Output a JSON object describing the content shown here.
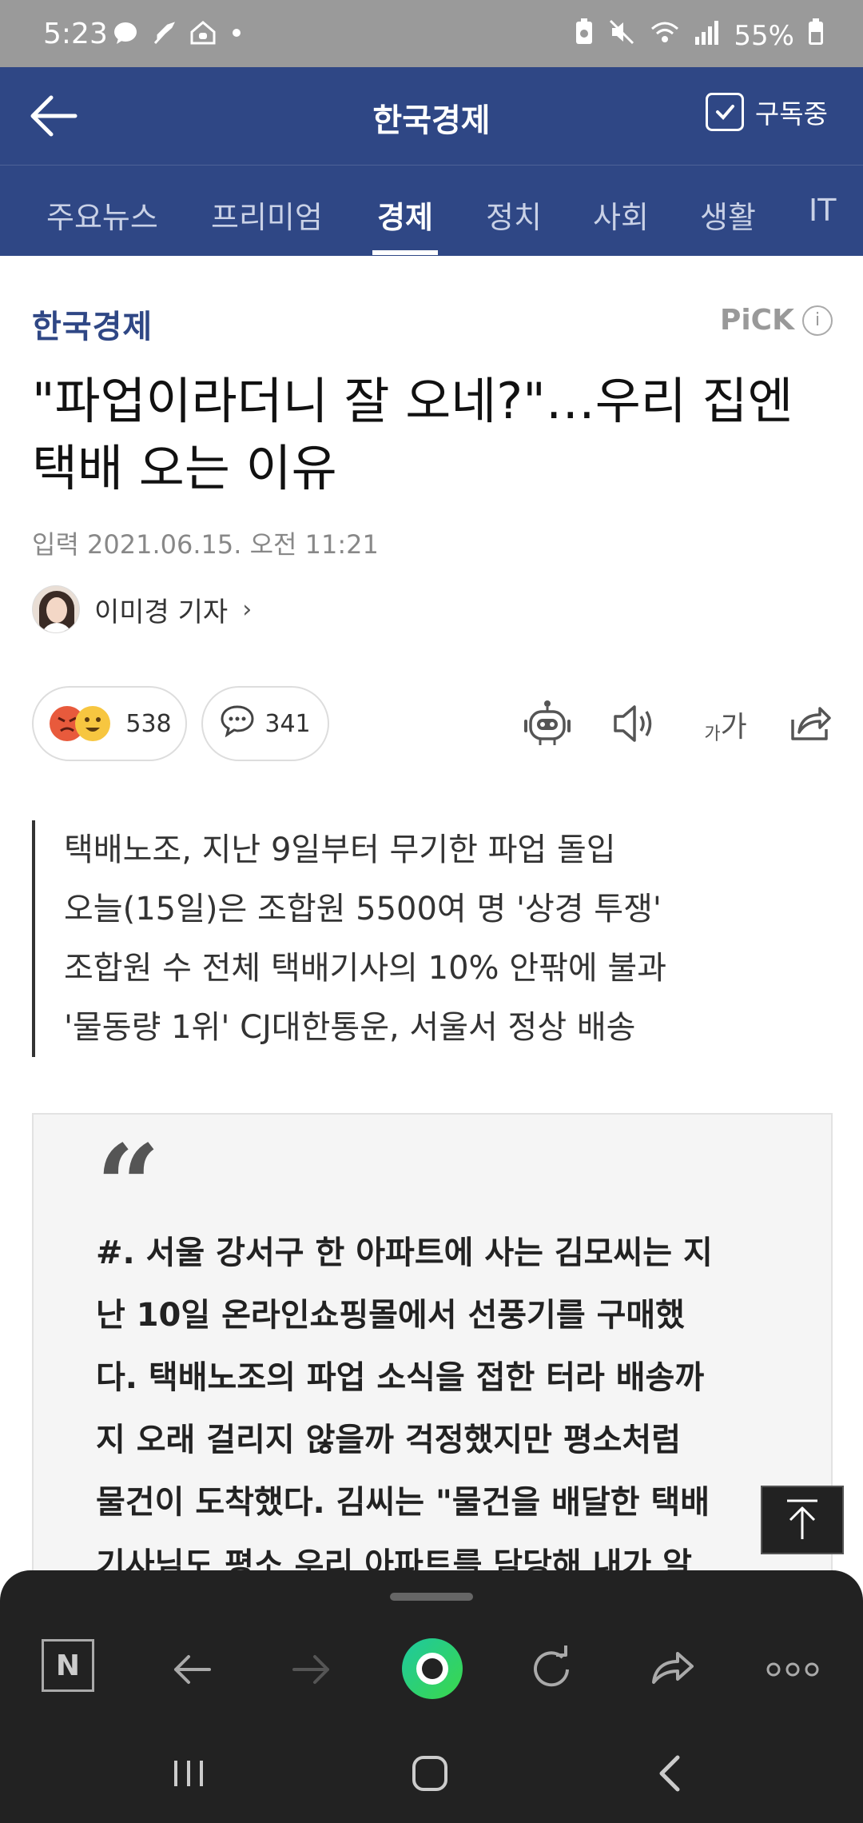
{
  "status_bar": {
    "time": "5:23",
    "battery": "55%",
    "icons": [
      "chat-bubble-icon",
      "feather-icon",
      "home-icon",
      "dot-icon",
      "battery-saver-icon",
      "mute-icon",
      "wifi-icon",
      "signal-icon",
      "battery-icon"
    ]
  },
  "header": {
    "title": "한국경제",
    "subscribe_label": "구독중"
  },
  "tabs": [
    {
      "label": "주요뉴스",
      "active": false
    },
    {
      "label": "프리미엄",
      "active": false
    },
    {
      "label": "경제",
      "active": true
    },
    {
      "label": "정치",
      "active": false
    },
    {
      "label": "사회",
      "active": false
    },
    {
      "label": "생활",
      "active": false
    },
    {
      "label": "IT",
      "active": false
    }
  ],
  "article": {
    "press": "한국경제",
    "pick_label": "PiCK",
    "pick_info": "i",
    "headline_line1": "\"파업이라더니 잘 오네?\"…우리 집엔",
    "headline_line2": "택배 오는 이유",
    "date": "입력 2021.06.15. 오전 11:21",
    "author": "이미경 기자",
    "author_chevron": "›",
    "reaction_count": "538",
    "comment_count": "341",
    "font_size_label_small": "가",
    "font_size_label_large": "가",
    "summary": [
      "택배노조, 지난 9일부터 무기한 파업 돌입",
      "오늘(15일)은 조합원 5500여 명 '상경 투쟁'",
      "조합원 수 전체 택배기사의 10% 안팎에 불과",
      "'물동량 1위' CJ대한통운, 서울서 정상 배송"
    ],
    "quote_mark": "“",
    "quote_lines": [
      "#. 서울 강서구 한 아파트에 사는 김모씨는 지",
      "난 10일 온라인쇼핑몰에서 선풍기를 구매했",
      "다. 택배노조의 파업 소식을 접한 터라 배송까",
      "지 오래 걸리지 않을까 걱정했지만 평소처럼",
      "물건이 도착했다. 김씨는 \"물건을 배달한 택배",
      "기사님도 평소 우리 아파트를 담당해 내가 알"
    ]
  },
  "bottom_bar": {
    "n_label": "N",
    "icons": [
      "naver-n-icon",
      "back-arrow-icon",
      "forward-arrow-icon",
      "green-dot-icon",
      "refresh-icon",
      "share-icon",
      "more-icon"
    ]
  },
  "colors": {
    "brand": "#2f4785",
    "status_bar": "#9a9a9a",
    "bottom_sheet": "#222222"
  }
}
